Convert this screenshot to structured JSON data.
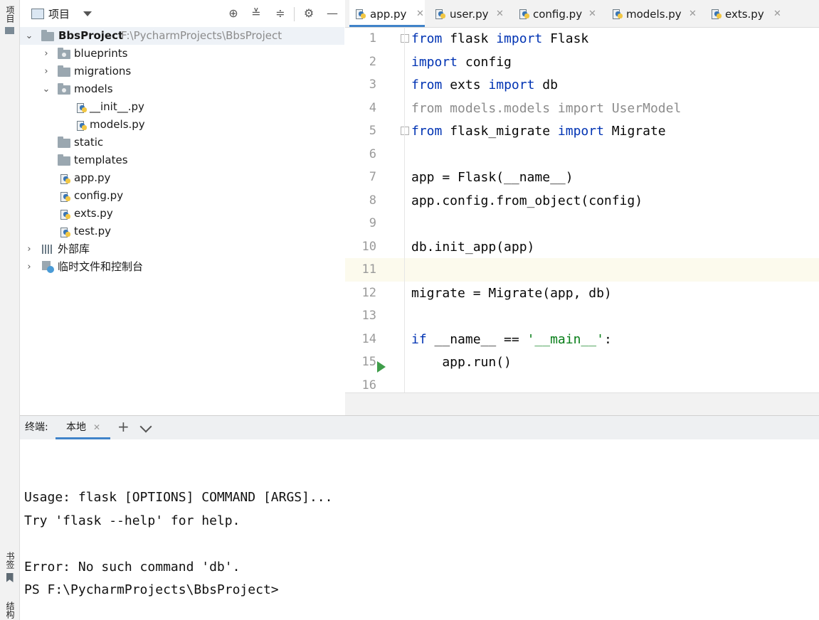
{
  "left_strip": {
    "project_tab": "项目",
    "bookmarks_tab": "书签",
    "structure_tab": "结构"
  },
  "project_panel": {
    "title": "项目",
    "icons": [
      "locate-icon",
      "expand-all-icon",
      "collapse-all-icon",
      "settings-icon",
      "hide-icon"
    ],
    "tree": [
      {
        "label": "BbsProject",
        "path": "F:\\PycharmProjects\\BbsProject",
        "type": "root-folder",
        "expanded": true
      },
      {
        "label": "blueprints",
        "type": "package-folder",
        "expanded": false
      },
      {
        "label": "migrations",
        "type": "folder",
        "expanded": false
      },
      {
        "label": "models",
        "type": "package-folder",
        "expanded": true
      },
      {
        "label": "__init__.py",
        "type": "python-file"
      },
      {
        "label": "models.py",
        "type": "python-file"
      },
      {
        "label": "static",
        "type": "folder"
      },
      {
        "label": "templates",
        "type": "folder"
      },
      {
        "label": "app.py",
        "type": "python-file"
      },
      {
        "label": "config.py",
        "type": "python-file"
      },
      {
        "label": "exts.py",
        "type": "python-file"
      },
      {
        "label": "test.py",
        "type": "python-file"
      },
      {
        "label": "外部库",
        "type": "libraries",
        "expanded": false
      },
      {
        "label": "临时文件和控制台",
        "type": "scratches",
        "expanded": false
      }
    ]
  },
  "editor_tabs": [
    {
      "label": "app.py",
      "active": true
    },
    {
      "label": "user.py",
      "active": false
    },
    {
      "label": "config.py",
      "active": false
    },
    {
      "label": "models.py",
      "active": false
    },
    {
      "label": "exts.py",
      "active": false
    }
  ],
  "editor": {
    "line_numbers": [
      "1",
      "2",
      "3",
      "4",
      "5",
      "6",
      "7",
      "8",
      "9",
      "10",
      "11",
      "12",
      "13",
      "14",
      "15",
      "16"
    ],
    "current_line": "11",
    "lines": [
      "from flask import Flask",
      "import config",
      "from exts import db",
      "from models.models import UserModel",
      "from flask_migrate import Migrate",
      "",
      "app = Flask(__name__)",
      "app.config.from_object(config)",
      "",
      "db.init_app(app)",
      "",
      "migrate = Migrate(app, db)",
      "",
      "if __name__ == '__main__':",
      "    app.run()",
      ""
    ]
  },
  "terminal": {
    "label": "终端:",
    "tab": "本地",
    "lines": [
      "Usage: flask [OPTIONS] COMMAND [ARGS]...",
      "Try 'flask --help' for help.",
      "",
      "Error: No such command 'db'.",
      "PS F:\\PycharmProjects\\BbsProject>"
    ]
  },
  "colors": {
    "keyword": "#0033b3",
    "string": "#067d17",
    "unused_import": "#8c8c8c",
    "run_marker": "#3f9d4a",
    "active_tab_underline": "#4083c9"
  }
}
